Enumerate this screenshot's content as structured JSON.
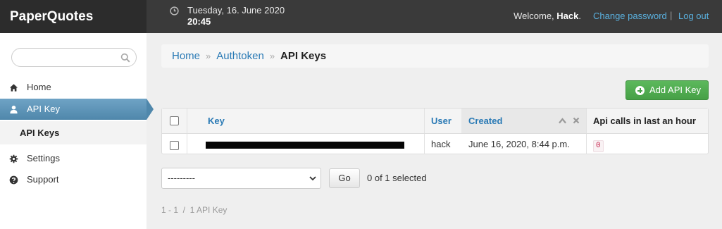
{
  "header": {
    "brand": "PaperQuotes",
    "date": "Tuesday, 16. June 2020",
    "time": "20:45",
    "welcome_prefix": "Welcome,",
    "username": "Hack",
    "welcome_suffix": ".",
    "change_password": "Change password",
    "separator": "|",
    "logout": "Log out"
  },
  "sidebar": {
    "search_placeholder": "",
    "items": [
      {
        "label": "Home",
        "icon": "home-icon"
      },
      {
        "label": "API Key",
        "icon": "user-icon"
      },
      {
        "label": "API Keys",
        "icon": ""
      },
      {
        "label": "Settings",
        "icon": "gear-icon"
      },
      {
        "label": "Support",
        "icon": "question-icon"
      }
    ]
  },
  "breadcrumb": {
    "items": [
      "Home",
      "Authtoken"
    ],
    "separator": "»",
    "current": "API Keys"
  },
  "actions": {
    "add_label": "Add API Key"
  },
  "table": {
    "columns": [
      "Key",
      "User",
      "Created",
      "Api calls in last an hour"
    ],
    "rows": [
      {
        "key": "",
        "user": "hack",
        "created": "June 16, 2020, 8:44 p.m.",
        "api_calls": "0"
      }
    ]
  },
  "bulk": {
    "select_value": "---------",
    "go_label": "Go",
    "selected_text": "0 of 1 selected"
  },
  "paginator": {
    "text": "1 - 1  /  1 API Key"
  },
  "colors": {
    "header_bg": "#3a3a3a",
    "brand_bg": "#2c2c2c",
    "accent_link": "#2a7ab5",
    "active_nav": "#5f95b8",
    "add_button": "#46a046"
  }
}
